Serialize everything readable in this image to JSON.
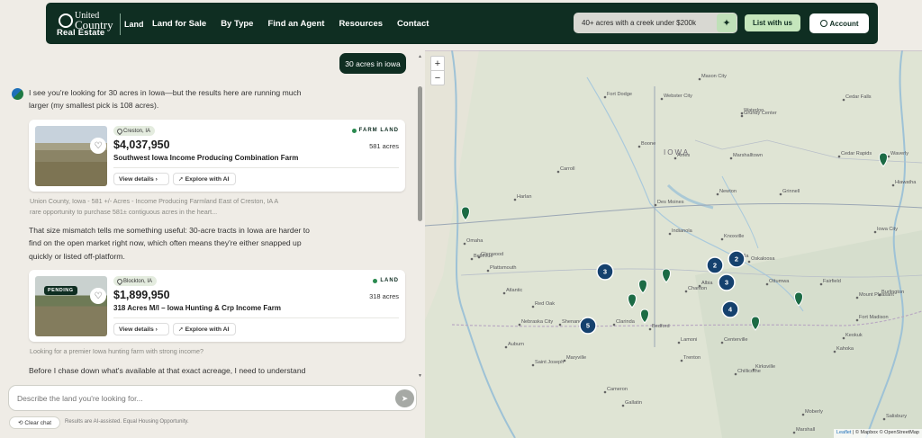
{
  "header": {
    "brand_line1": "United",
    "brand_line1b": "Country",
    "brand_line2": "Real Estate",
    "brand_section": "Land",
    "nav": [
      "Land for Sale",
      "By Type",
      "Find an Agent",
      "Resources",
      "Contact"
    ],
    "search_value": "40+ acres with a creek under $200k",
    "list_button": "List with us",
    "account_button": "Account"
  },
  "chat": {
    "user_message": "30 acres in iowa",
    "intro": "I see you're looking for 30 acres in Iowa—but the results here are running much larger (my smallest pick is 108 acres).",
    "middle": "That size mismatch tells me something useful: 30-acre tracts in Iowa are harder to find on the open market right now, which often means they're either snapped up quickly or listed off-platform.",
    "outro": "Before I chase down what's available at that exact acreage, I need to understand",
    "listings": [
      {
        "location": "Creston, IA",
        "type": "FARM LAND",
        "price": "$4,037,950",
        "acres": "581 acres",
        "title": "Southwest Iowa Income Producing Combination Farm",
        "snippet": "Union County, Iowa - 581 +/- Acres - Income Producing Farmland East of Creston, IA A rare opportunity to purchase 581± contiguous acres in the heart...",
        "pending": ""
      },
      {
        "location": "Blockton, IA",
        "type": "LAND",
        "price": "$1,899,950",
        "acres": "318 acres",
        "title": "318 Acres M/l – Iowa Hunting & Crp Income Farm",
        "snippet": "Looking for a premier Iowa hunting farm with strong income?",
        "pending": "PENDING"
      }
    ],
    "view_details": "View details",
    "explore_ai": "Explore with AI",
    "input_placeholder": "Describe the land you're looking for...",
    "clear_chat": "Clear chat",
    "disclaimer": "Results are AI-assisted. Equal Housing Opportunity."
  },
  "map": {
    "zoom_in": "+",
    "zoom_out": "−",
    "state_label": "IOWA",
    "cities": [
      "Fort Dodge",
      "Webster City",
      "Mason City",
      "Waterloo",
      "Grundy Center",
      "Cedar Falls",
      "Boone",
      "Ames",
      "Marshalltown",
      "Carroll",
      "Harlan",
      "Des Moines",
      "Newton",
      "Grinnell",
      "Iowa City",
      "Cedar Rapids",
      "Omaha",
      "Bellevue",
      "Indianola",
      "Knoxville",
      "Albia",
      "Ottumwa",
      "Atlantic",
      "Red Oak",
      "Shenandoah",
      "Clarinda",
      "Bedford",
      "Lamoni",
      "Maryville",
      "Chillicothe",
      "Trenton",
      "Kirksville",
      "Fairfield",
      "Mount Pleasant",
      "Burlington",
      "Fort Madison",
      "Keokuk",
      "Oskaloosa",
      "Pella",
      "Chariton",
      "Centerville",
      "Moberly",
      "Saint Joseph",
      "Kahoka",
      "Plattsmouth",
      "Nebraska City",
      "Auburn",
      "Marshall",
      "Salisbury",
      "Glenwood",
      "Cameron",
      "Gallatin",
      "Hiawatha",
      "Waverly"
    ],
    "clusters": [
      "3",
      "2",
      "2",
      "3",
      "4",
      "5"
    ],
    "attribution_leaflet": "Leaflet",
    "attribution_rest": "| © Mapbox © OpenStreetMap"
  }
}
